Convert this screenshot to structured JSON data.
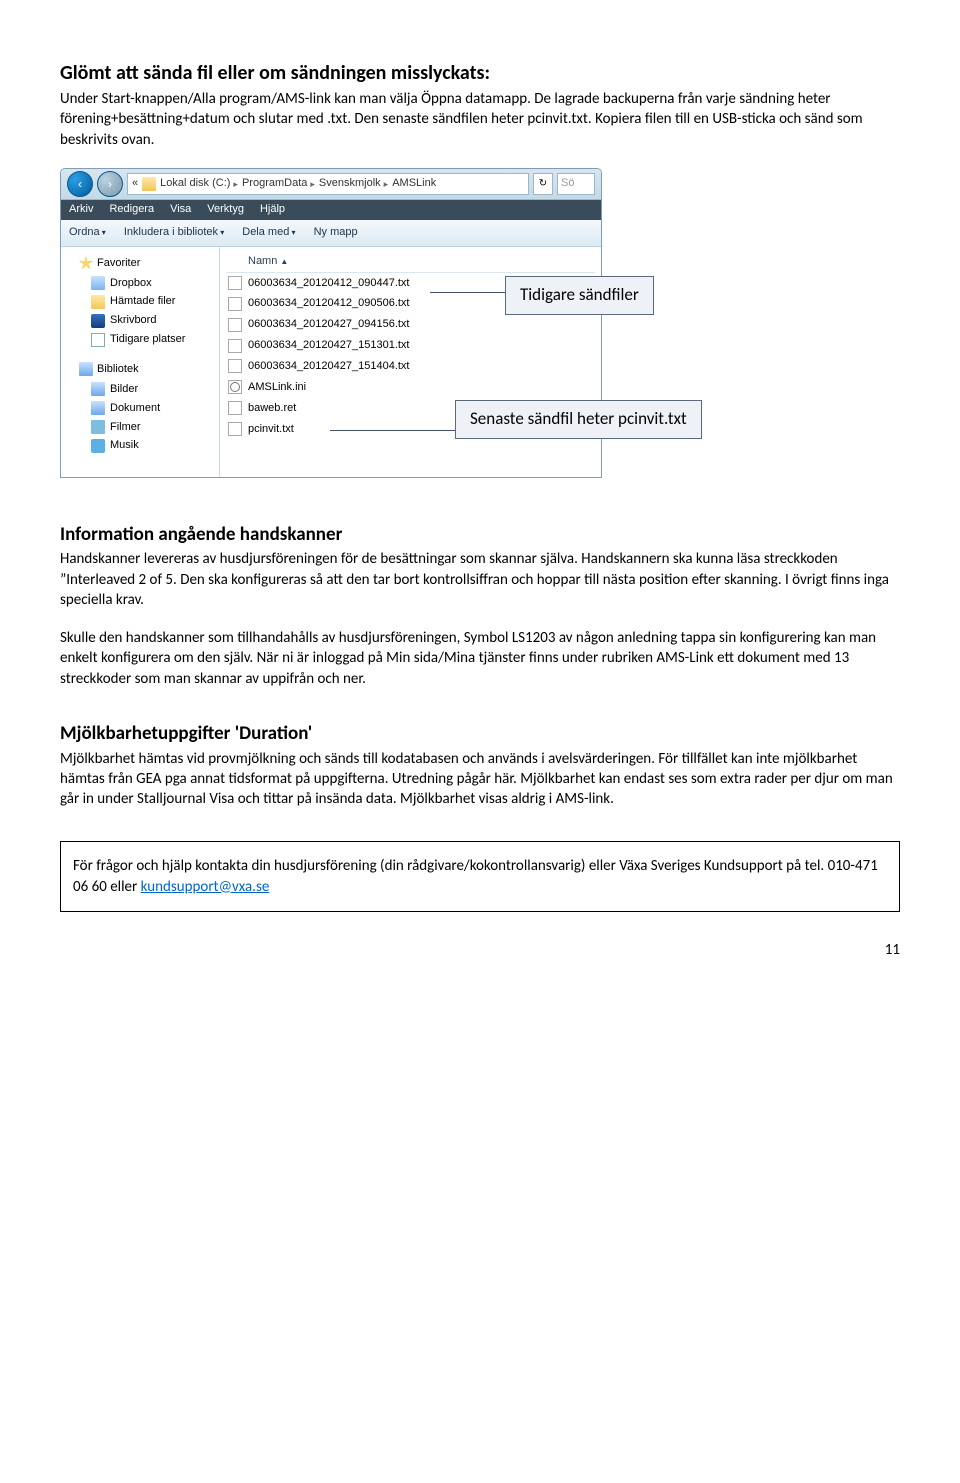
{
  "section1": {
    "title": "Glömt att sända fil eller om sändningen misslyckats:",
    "body": "Under Start-knappen/Alla program/AMS-link kan man välja Öppna datamapp. De lagrade backuperna från varje sändning heter förening+besättning+datum och slutar med .txt. Den senaste sändfilen heter pcinvit.txt. Kopiera filen till en USB-sticka och sänd som beskrivits ovan."
  },
  "explorer": {
    "breadcrumb_leader": "«",
    "breadcrumbs": [
      "Lokal disk (C:)",
      "ProgramData",
      "Svenskmjolk",
      "AMSLink"
    ],
    "search_placeholder": "Sö",
    "menus": [
      "Arkiv",
      "Redigera",
      "Visa",
      "Verktyg",
      "Hjälp"
    ],
    "toolbar": [
      "Ordna",
      "Inkludera i bibliotek",
      "Dela med",
      "Ny mapp"
    ],
    "sidebar_fav_title": "Favoriter",
    "sidebar_fav": [
      "Dropbox",
      "Hämtade filer",
      "Skrivbord",
      "Tidigare platser"
    ],
    "sidebar_lib_title": "Bibliotek",
    "sidebar_lib": [
      "Bilder",
      "Dokument",
      "Filmer",
      "Musik"
    ],
    "col_name": "Namn",
    "files": [
      "06003634_20120412_090447.txt",
      "06003634_20120412_090506.txt",
      "06003634_20120427_094156.txt",
      "06003634_20120427_151301.txt",
      "06003634_20120427_151404.txt",
      "AMSLink.ini",
      "baweb.ret",
      "pcinvit.txt"
    ],
    "callout_prev": "Tidigare sändfiler",
    "callout_latest": "Senaste sändfil heter pcinvit.txt"
  },
  "section2": {
    "title": "Information angående handskanner",
    "p1": "Handskanner levereras av husdjursföreningen för de besättningar som skannar själva. Handskannern ska kunna läsa streckkoden ”Interleaved 2 of 5. Den ska konfigureras så att den tar bort kontrollsiffran och hoppar till nästa position efter skanning. I övrigt finns inga speciella krav.",
    "p2": "Skulle den handskanner som tillhandahålls av husdjursföreningen, Symbol LS1203 av någon anledning tappa sin konfigurering kan man enkelt konfigurera om den själv. När ni är inloggad på Min sida/Mina tjänster finns under rubriken AMS-Link ett dokument med 13 streckkoder som man skannar av uppifrån och ner."
  },
  "section3": {
    "title": "Mjölkbarhetuppgifter 'Duration'",
    "p1": "Mjölkbarhet hämtas vid provmjölkning och sänds till kodatabasen och används i avelsvärderingen. För tillfället kan inte mjölkbarhet hämtas från GEA pga annat tidsformat på uppgifterna. Utredning pågår här. Mjölkbarhet kan endast ses som extra rader per djur om man går in under Stalljournal Visa och tittar på insända data. Mjölkbarhet visas aldrig i AMS-link."
  },
  "contact": {
    "text_pre": "För frågor och hjälp kontakta din husdjursförening (din rådgivare/kokontrollansvarig)  eller Växa Sveriges Kundsupport  på tel. 010-471 06 60  eller ",
    "link": "kundsupport@vxa.se"
  },
  "page_number": "11"
}
